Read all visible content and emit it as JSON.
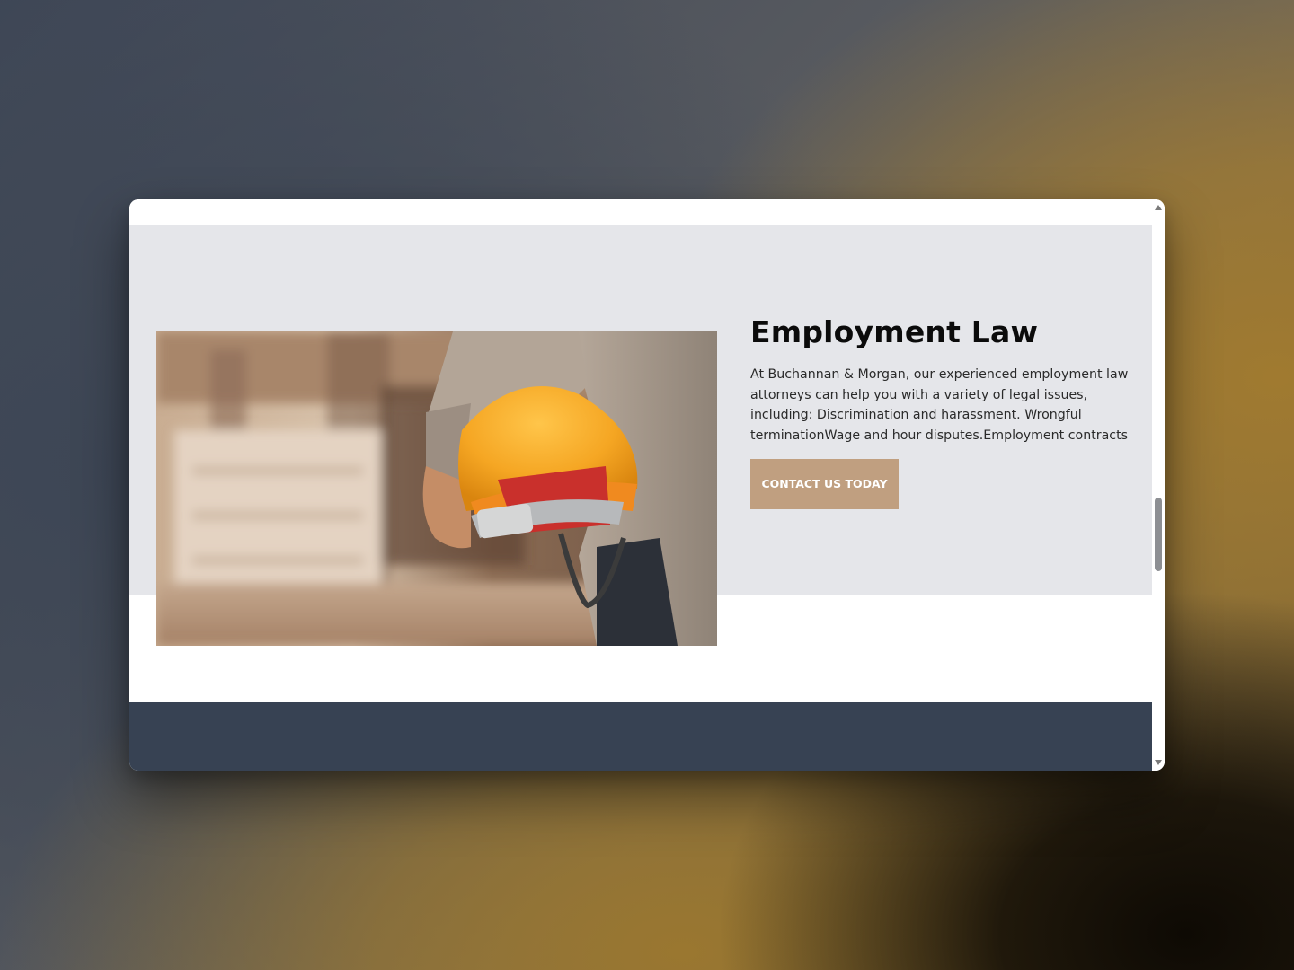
{
  "section": {
    "title": "Employment Law",
    "description": "At Buchannan & Morgan, our experienced employment law attorneys can help you with a variety of legal issues, including: Discrimination and harassment. Wrongful terminationWage and hour disputes.Employment contracts",
    "cta_label": "CONTACT US TODAY",
    "image_icon": "worker-holding-hard-hat-photo"
  },
  "scrollbar": {
    "up_icon": "scroll-up-arrow-icon",
    "down_icon": "scroll-down-arrow-icon"
  },
  "colors": {
    "section_background": "#e5e6ea",
    "cta_background": "#c09f80",
    "footer_background": "#374253",
    "title_color": "#0b0b0b"
  }
}
